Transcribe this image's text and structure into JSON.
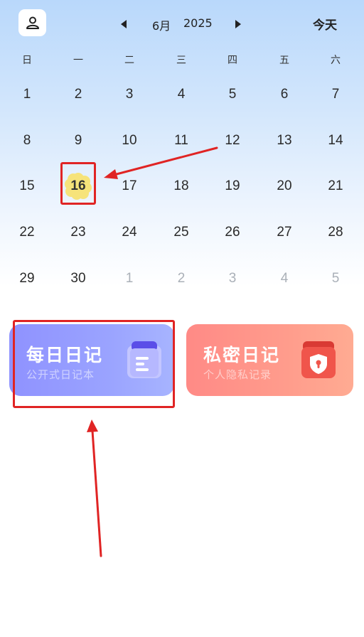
{
  "header": {
    "month": "6月",
    "year": "2025",
    "today_label": "今天",
    "icons": {
      "profile": "user-icon",
      "prev": "triangle-left-icon",
      "next": "triangle-right-icon"
    }
  },
  "weekdays": [
    "日",
    "一",
    "二",
    "三",
    "四",
    "五",
    "六"
  ],
  "calendar": {
    "selected_day": "16",
    "weeks": [
      [
        "1",
        "2",
        "3",
        "4",
        "5",
        "6",
        "7"
      ],
      [
        "8",
        "9",
        "10",
        "11",
        "12",
        "13",
        "14"
      ],
      [
        "15",
        "16",
        "17",
        "18",
        "19",
        "20",
        "21"
      ],
      [
        "22",
        "23",
        "24",
        "25",
        "26",
        "27",
        "28"
      ],
      [
        "29",
        "30",
        "1",
        "2",
        "3",
        "4",
        "5"
      ]
    ]
  },
  "cards": {
    "daily": {
      "title": "每日日记",
      "subtitle": "公开式日记本",
      "icon": "notebook-icon",
      "color": "#8f92ff"
    },
    "private": {
      "title": "私密日记",
      "subtitle": "个人隐私记录",
      "icon": "shield-lock-icon",
      "color": "#ff8a86"
    }
  },
  "colors": {
    "annotation_red": "#e02424",
    "selected_flower": "#f6e37a"
  }
}
